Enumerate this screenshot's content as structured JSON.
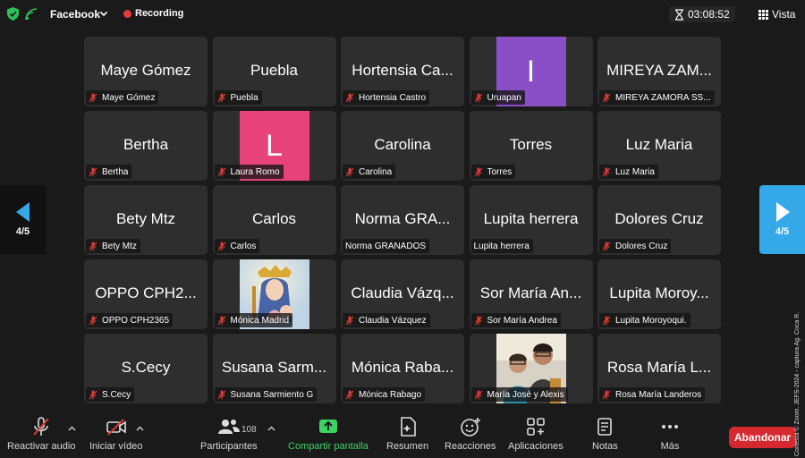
{
  "topbar": {
    "meeting_name": "Facebook",
    "recording_label": "Recording",
    "timer": "03:08:52",
    "view_label": "Vista"
  },
  "colors": {
    "recording": "#e8383b",
    "accent_blue": "#35a8e8",
    "share_green": "#3cd365",
    "leave_red": "#d6282f",
    "avatar_purple": "#8a4ec7",
    "avatar_pink": "#e8427a"
  },
  "tiles": [
    {
      "big": "Maye Gómez",
      "label": "Maye Gómez",
      "muted": true
    },
    {
      "big": "Puebla",
      "label": "Puebla",
      "muted": true
    },
    {
      "big": "Hortensia Ca...",
      "label": "Hortensia Castro",
      "muted": true
    },
    {
      "avatar": "I",
      "avatar_color": "#8a4ec7",
      "label": "Uruapan",
      "muted": true
    },
    {
      "big": "MIREYA ZAM...",
      "label": "MIREYA ZAMORA SS...",
      "muted": true
    },
    {
      "big": "Bertha",
      "label": "Bertha",
      "muted": true
    },
    {
      "avatar": "L",
      "avatar_color": "#e8427a",
      "label": "Laura Romo",
      "muted": true
    },
    {
      "big": "Carolina",
      "label": "Carolina",
      "muted": true
    },
    {
      "big": "Torres",
      "label": "Torres",
      "muted": true
    },
    {
      "big": "Luz Maria",
      "label": "Luz Maria",
      "muted": true
    },
    {
      "big": "Bety Mtz",
      "label": "Bety Mtz",
      "muted": true
    },
    {
      "big": "Carlos",
      "label": "Carlos",
      "muted": true
    },
    {
      "big": "Norma GRA...",
      "label": "Norma GRANADOS",
      "muted": false
    },
    {
      "big": "Lupita herrera",
      "label": "Lupita herrera",
      "muted": false
    },
    {
      "big": "Dolores Cruz",
      "label": "Dolores Cruz",
      "muted": true
    },
    {
      "big": "OPPO CPH2...",
      "label": "OPPO CPH2365",
      "muted": true
    },
    {
      "photo": "virgin",
      "label": "Mónica Madrid",
      "muted": true
    },
    {
      "big": "Claudia Vázq...",
      "label": "Claudia Vázquez",
      "muted": true
    },
    {
      "big": "Sor María An...",
      "label": "Sor María Andrea",
      "muted": true
    },
    {
      "big": "Lupita Moroy...",
      "label": "Lupita Moroyoqui.",
      "muted": true
    },
    {
      "big": "S.Cecy",
      "label": "S.Cecy",
      "muted": true
    },
    {
      "big": "Susana Sarm...",
      "label": "Susana Sarmiento G",
      "muted": true
    },
    {
      "big": "Mónica Raba...",
      "label": "Mónica Rabago",
      "muted": true
    },
    {
      "photo": "people",
      "label": "María José y Alexis",
      "muted": true
    },
    {
      "big": "Rosa María L...",
      "label": "Rosa María Landeros",
      "muted": true
    }
  ],
  "pager": {
    "left": "4/5",
    "right": "4/5"
  },
  "toolbar": {
    "audio": "Reactivar audio",
    "video": "Iniciar vídeo",
    "participants": "Participantes",
    "participants_count": "108",
    "share": "Compartir pantalla",
    "summary": "Resumen",
    "reactions": "Reacciones",
    "apps": "Aplicaciones",
    "notes": "Notas",
    "more": "Más",
    "leave": "Abandonar"
  },
  "credit": "Cortesía © Zoom. JEFS-2024 - captura Ag. Coca R."
}
